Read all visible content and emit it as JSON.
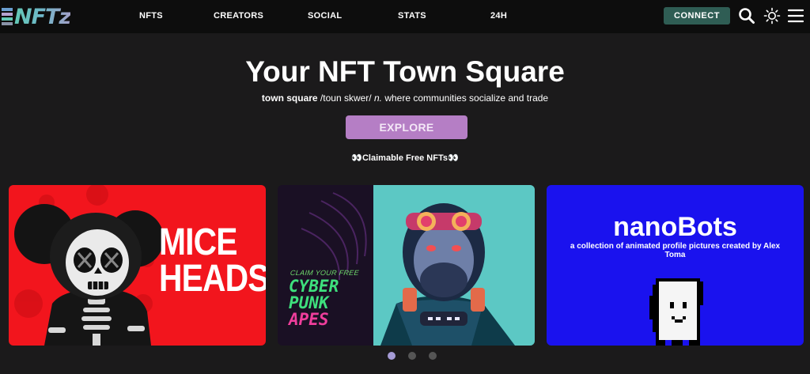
{
  "brand": {
    "name": "NFTz",
    "colors": [
      "#6a9fd0",
      "#b6a3cf",
      "#63c9b6",
      "#8a93a8"
    ]
  },
  "nav": {
    "items": [
      {
        "label": "NFTS"
      },
      {
        "label": "CREATORS"
      },
      {
        "label": "SOCIAL"
      },
      {
        "label": "STATS"
      },
      {
        "label": "24H"
      }
    ],
    "connect_label": "CONNECT",
    "icons": [
      "search-icon",
      "sun-icon",
      "menu-icon"
    ]
  },
  "hero": {
    "title": "Your NFT Town Square",
    "term": "town square",
    "pronunciation": " /toun skwer/ ",
    "pos": "n.",
    "definition": " where communities socialize and trade",
    "explore_label": "EXPLORE",
    "claim_label": "👀Claimable Free NFTs👀"
  },
  "carousel": {
    "cards": [
      {
        "title_line1": "MICE",
        "title_line2": "HEADS",
        "background": "#f2151d"
      },
      {
        "claim": "CLAIM YOUR FREE",
        "line1": "CYBER",
        "line2": "PUNK",
        "line3": "APES",
        "background": "#1a1024"
      },
      {
        "title": "nanoBots",
        "description": "a collection of animated profile pictures created by Alex Toma",
        "background": "#1a12ee"
      }
    ],
    "active_index": 0,
    "dot_count": 3,
    "dot_active_color": "#a59bd6",
    "dot_inactive_color": "#555555"
  }
}
